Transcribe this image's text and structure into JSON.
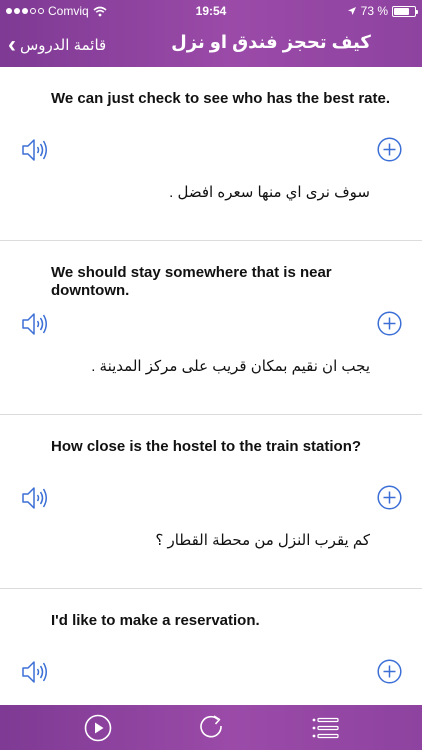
{
  "status_bar": {
    "carrier": "Comviq",
    "time": "19:54",
    "battery_text": "73 %",
    "battery_level": 0.73
  },
  "nav": {
    "back_label": "قائمة الدروس",
    "title": "كيف تحجز فندق او نزل"
  },
  "items": [
    {
      "english": "We can just check to see who has the best rate.",
      "arabic": "سوف نرى اي منها سعره افضل ."
    },
    {
      "english": "We should stay somewhere that is near downtown.",
      "arabic": "يجب ان نقيم بمكان قريب على مركز المدينة ."
    },
    {
      "english": "How close is the hostel to the train station?",
      "arabic": "كم يقرب النزل من محطة القطار ؟"
    },
    {
      "english": "I'd like to make a reservation.",
      "arabic": ""
    }
  ],
  "icons": {
    "speaker": "speaker-icon",
    "add": "plus-circle-icon",
    "play": "play-icon",
    "repeat": "repeat-icon",
    "menu": "list-menu-icon"
  },
  "colors": {
    "header_purple": "#8e43a0",
    "icon_blue": "#3b6fd6",
    "separator": "#dcdcdc"
  }
}
